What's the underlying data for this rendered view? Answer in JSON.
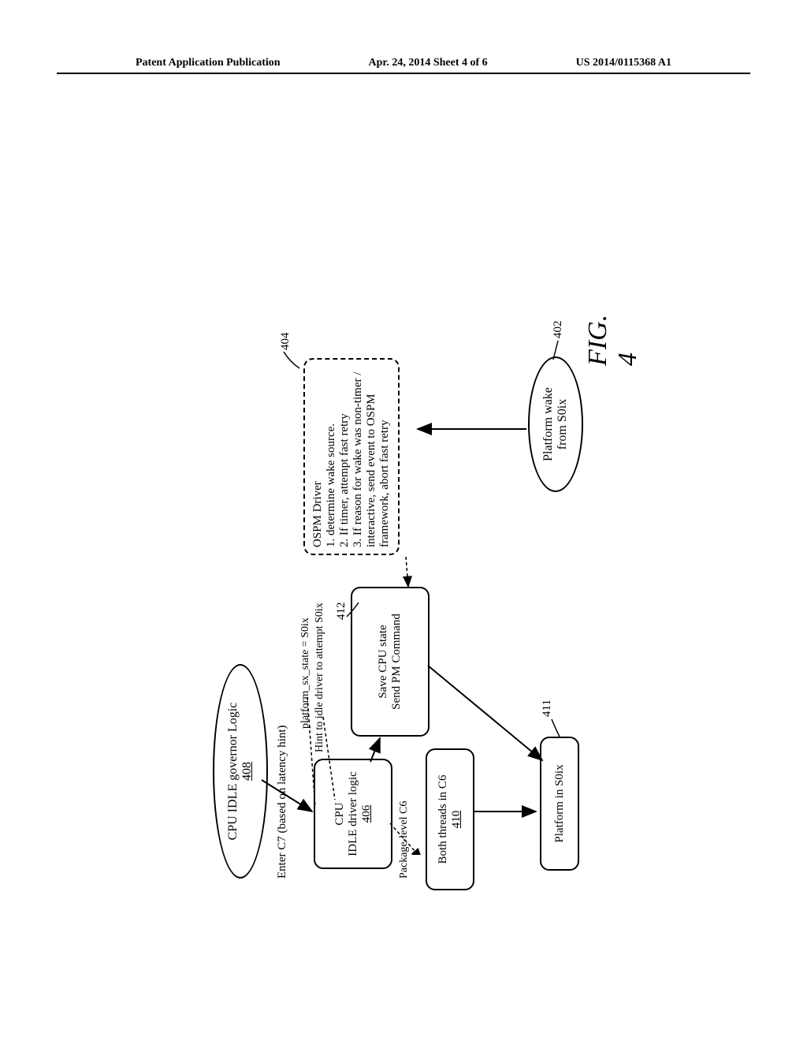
{
  "header": {
    "left": "Patent Application Publication",
    "center": "Apr. 24, 2014  Sheet 4 of 6",
    "right": "US 2014/0115368 A1"
  },
  "diagram": {
    "governor": {
      "title": "CPU IDLE governor Logic",
      "ref": "408"
    },
    "enter_c7": "Enter C7 (based on latency hint)",
    "idle_driver": {
      "line1": "CPU",
      "line2": "IDLE driver logic",
      "ref": "406"
    },
    "platform_sx_line1": "platform_sx_state = S0ix",
    "platform_sx_line2": "Hint to idle driver to attempt S0ix",
    "save_cpu": {
      "line1": "Save CPU state",
      "line2": "Send PM Command"
    },
    "package_level": "Package-level C6",
    "both_threads": {
      "text": "Both threads in C6",
      "ref": "410"
    },
    "platform_s0ix": "Platform in S0ix",
    "platform_wake": {
      "line1": "Platform wake",
      "line2": "from S0ix"
    },
    "ospm": {
      "title": "OSPM Driver",
      "item1": "1. determine wake source.",
      "item2": "2. If timer, attempt fast retry",
      "item3": "3. If reason for wake was non-timer / interactive, send event to OSPM framework, abort fast retry"
    },
    "callouts": {
      "c404": "404",
      "c412": "412",
      "c411": "411",
      "c402": "402"
    },
    "fig_label": "FIG. 4"
  }
}
